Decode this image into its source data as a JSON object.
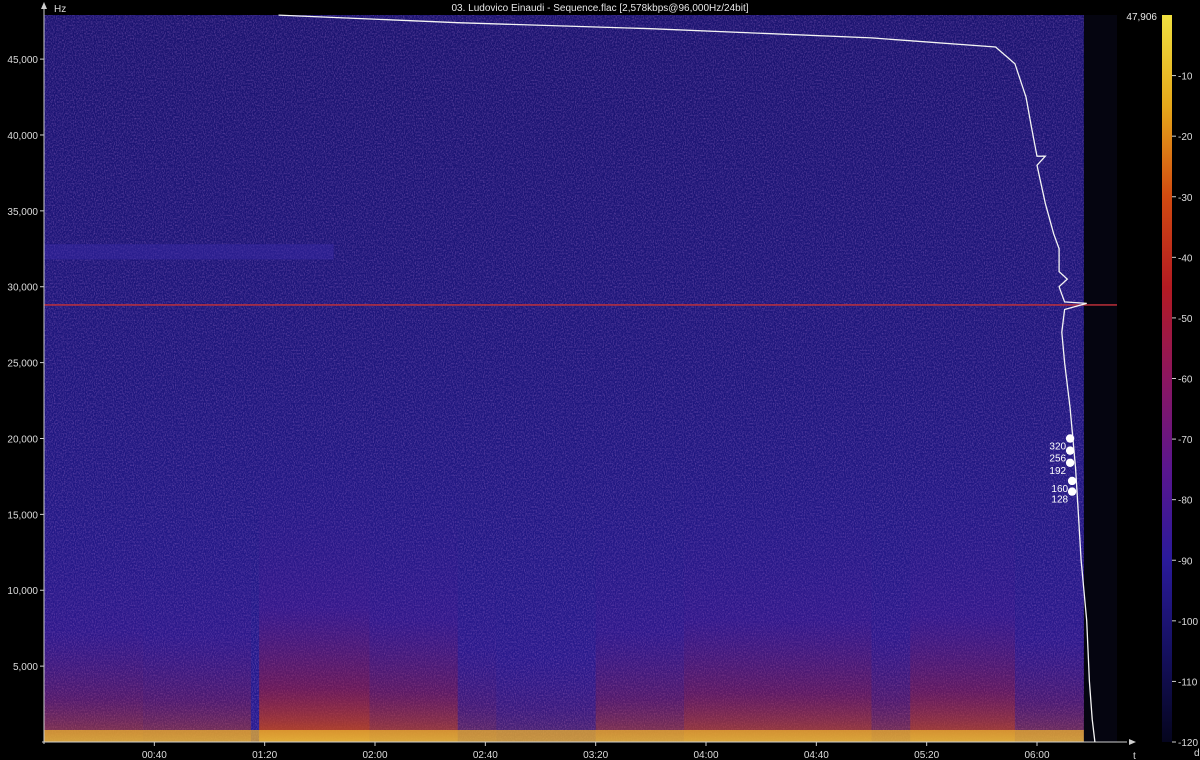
{
  "window": {
    "title": "03. Ludovico Einaudi - Sequence.flac [2,578kbps@96,000Hz/24bit]"
  },
  "chart_data": {
    "type": "heatmap",
    "title": "03. Ludovico Einaudi - Sequence.flac [2,578kbps@96,000Hz/24bit]",
    "xlabel": "t",
    "ylabel": "Hz",
    "colorbar_label": "dB",
    "max_freq_label": "47,906",
    "ylim": [
      0,
      47906
    ],
    "xlim_seconds": [
      0,
      389
    ],
    "y_ticks": [
      {
        "value": 5000,
        "label": "5,000"
      },
      {
        "value": 10000,
        "label": "10,000"
      },
      {
        "value": 15000,
        "label": "15,000"
      },
      {
        "value": 20000,
        "label": "20,000"
      },
      {
        "value": 25000,
        "label": "25,000"
      },
      {
        "value": 30000,
        "label": "30,000"
      },
      {
        "value": 35000,
        "label": "35,000"
      },
      {
        "value": 40000,
        "label": "40,000"
      },
      {
        "value": 45000,
        "label": "45,000"
      }
    ],
    "x_ticks": [
      {
        "value": 40,
        "label": "00:40"
      },
      {
        "value": 80,
        "label": "01:20"
      },
      {
        "value": 120,
        "label": "02:00"
      },
      {
        "value": 160,
        "label": "02:40"
      },
      {
        "value": 200,
        "label": "03:20"
      },
      {
        "value": 240,
        "label": "04:00"
      },
      {
        "value": 280,
        "label": "04:40"
      },
      {
        "value": 320,
        "label": "05:20"
      },
      {
        "value": 360,
        "label": "06:00"
      }
    ],
    "db_range": [
      -120,
      0
    ],
    "db_ticks": [
      {
        "value": -10,
        "label": "-10"
      },
      {
        "value": -20,
        "label": "-20"
      },
      {
        "value": -30,
        "label": "-30"
      },
      {
        "value": -40,
        "label": "-40"
      },
      {
        "value": -50,
        "label": "-50"
      },
      {
        "value": -60,
        "label": "-60"
      },
      {
        "value": -70,
        "label": "-70"
      },
      {
        "value": -80,
        "label": "-80"
      },
      {
        "value": -90,
        "label": "-90"
      },
      {
        "value": -100,
        "label": "-100"
      },
      {
        "value": -110,
        "label": "-110"
      },
      {
        "value": -120,
        "label": "-120"
      }
    ],
    "colormap": [
      "#05051e",
      "#151060",
      "#2a1a9a",
      "#5a168f",
      "#8c1660",
      "#b31a22",
      "#d24a10",
      "#e6a81a",
      "#f0e040"
    ],
    "constant_tone_hz": 28800,
    "bitrate_markers": [
      {
        "label": "320",
        "hz": 20000
      },
      {
        "label": "256",
        "hz": 19200
      },
      {
        "label": "192",
        "hz": 18400
      },
      {
        "label": "160",
        "hz": 17200
      },
      {
        "label": "128",
        "hz": 16500
      }
    ],
    "cutoff_curve": [
      {
        "t": 85,
        "hz": 47900
      },
      {
        "t": 150,
        "hz": 47400
      },
      {
        "t": 220,
        "hz": 47000
      },
      {
        "t": 300,
        "hz": 46400
      },
      {
        "t": 345,
        "hz": 45800
      },
      {
        "t": 352,
        "hz": 44700
      },
      {
        "t": 356,
        "hz": 42500
      },
      {
        "t": 358,
        "hz": 40500
      },
      {
        "t": 360,
        "hz": 38600
      },
      {
        "t": 363,
        "hz": 38600
      },
      {
        "t": 360,
        "hz": 38000
      },
      {
        "t": 363,
        "hz": 35500
      },
      {
        "t": 366,
        "hz": 33500
      },
      {
        "t": 368,
        "hz": 32500
      },
      {
        "t": 368,
        "hz": 31000
      },
      {
        "t": 371,
        "hz": 30500
      },
      {
        "t": 368,
        "hz": 30000
      },
      {
        "t": 369,
        "hz": 29500
      },
      {
        "t": 370,
        "hz": 29000
      },
      {
        "t": 378,
        "hz": 28900
      },
      {
        "t": 370,
        "hz": 28500
      },
      {
        "t": 369,
        "hz": 27000
      },
      {
        "t": 370,
        "hz": 25000
      },
      {
        "t": 372,
        "hz": 22000
      },
      {
        "t": 373,
        "hz": 20000
      },
      {
        "t": 374,
        "hz": 18000
      },
      {
        "t": 375,
        "hz": 15000
      },
      {
        "t": 376,
        "hz": 12000
      },
      {
        "t": 378,
        "hz": 8000
      },
      {
        "t": 379,
        "hz": 4000
      },
      {
        "t": 380,
        "hz": 1500
      },
      {
        "t": 381,
        "hz": 0
      }
    ]
  }
}
